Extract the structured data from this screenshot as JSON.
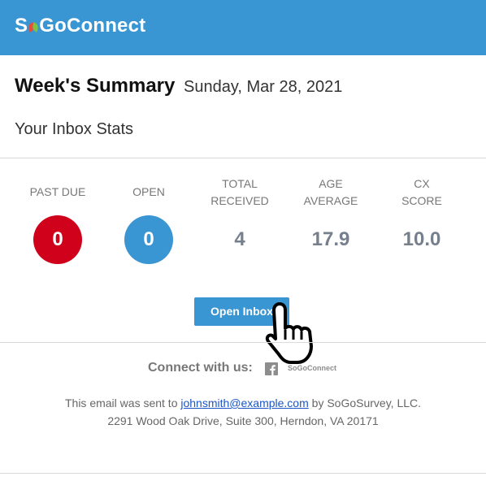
{
  "header": {
    "logo_prefix": "S",
    "logo_suffix": "GoConnect",
    "brand_color": "#3a95d3"
  },
  "summary": {
    "title": "Week's Summary",
    "date": "Sunday, Mar 28, 2021",
    "subtitle": "Your Inbox Stats"
  },
  "stats": [
    {
      "label_line1": "PAST DUE",
      "label_line2": "",
      "value": "0",
      "style": "circle",
      "color": "#d0021b"
    },
    {
      "label_line1": "OPEN",
      "label_line2": "",
      "value": "0",
      "style": "circle",
      "color": "#3a95d3"
    },
    {
      "label_line1": "TOTAL",
      "label_line2": "RECEIVED",
      "value": "4",
      "style": "plain"
    },
    {
      "label_line1": "AGE",
      "label_line2": "AVERAGE",
      "value": "17.9",
      "style": "plain"
    },
    {
      "label_line1": "CX",
      "label_line2": "SCORE",
      "value": "10.0",
      "style": "plain"
    }
  ],
  "actions": {
    "open_inbox_label": "Open Inbox"
  },
  "connect": {
    "label": "Connect with us:",
    "facebook_icon": "facebook-icon",
    "small_logo_text": "SoGoConnect"
  },
  "footer": {
    "line1_prefix": "This email was sent to ",
    "email": "johnsmith@example.com",
    "line1_suffix": " by SoGoSurvey, LLC.",
    "address": "2291 Wood Oak Drive, Suite 300, Herndon, VA 20171"
  }
}
